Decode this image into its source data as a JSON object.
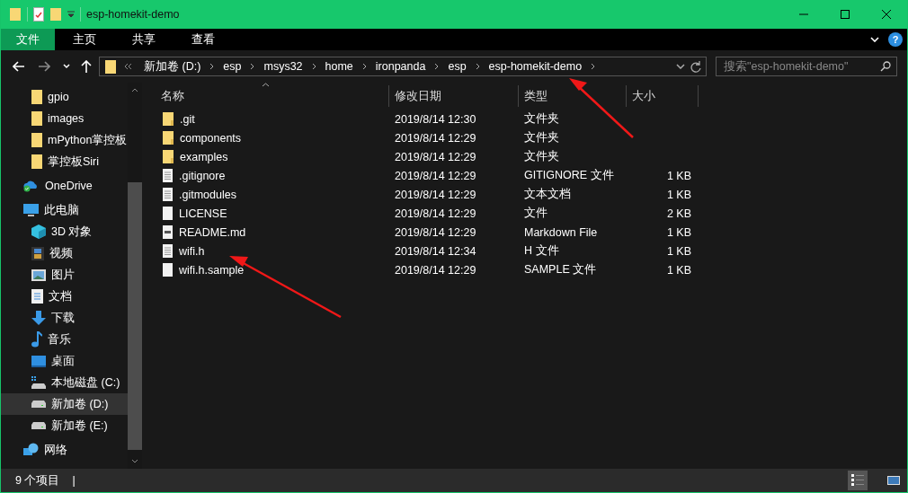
{
  "window": {
    "title": "esp-homekit-demo"
  },
  "ribbon": {
    "tabs": [
      {
        "label": "文件",
        "selected": true
      },
      {
        "label": "主页",
        "selected": false
      },
      {
        "label": "共享",
        "selected": false
      },
      {
        "label": "查看",
        "selected": false
      }
    ],
    "help": "?"
  },
  "address": {
    "segments": [
      "新加卷 (D:)",
      "esp",
      "msys32",
      "home",
      "ironpanda",
      "esp",
      "esp-homekit-demo"
    ]
  },
  "search": {
    "placeholder": "搜索\"esp-homekit-demo\""
  },
  "sidebar": {
    "quick_access_tail": [
      {
        "label": "gpio",
        "kind": "folder",
        "selected": false
      },
      {
        "label": "images",
        "kind": "folder",
        "selected": false
      },
      {
        "label": "mPython掌控板",
        "kind": "folder",
        "selected": false
      },
      {
        "label": "掌控板Siri",
        "kind": "folder",
        "selected": false
      }
    ],
    "items": [
      {
        "label": "OneDrive",
        "kind": "onedrive",
        "selected": false
      },
      {
        "label": "此电脑",
        "kind": "pc",
        "selected": false,
        "children": [
          {
            "label": "3D 对象",
            "kind": "cube",
            "selected": false
          },
          {
            "label": "视频",
            "kind": "video",
            "selected": false
          },
          {
            "label": "图片",
            "kind": "picture",
            "selected": false
          },
          {
            "label": "文档",
            "kind": "document",
            "selected": false
          },
          {
            "label": "下载",
            "kind": "download",
            "selected": false
          },
          {
            "label": "音乐",
            "kind": "music",
            "selected": false
          },
          {
            "label": "桌面",
            "kind": "desktop",
            "selected": false
          },
          {
            "label": "本地磁盘 (C:)",
            "kind": "system-drive",
            "selected": false
          },
          {
            "label": "新加卷 (D:)",
            "kind": "drive",
            "selected": true
          },
          {
            "label": "新加卷 (E:)",
            "kind": "drive",
            "selected": false
          }
        ]
      },
      {
        "label": "网络",
        "kind": "network",
        "selected": false
      }
    ]
  },
  "table": {
    "columns": [
      "名称",
      "修改日期",
      "类型",
      "大小"
    ],
    "rows": [
      {
        "name": ".git",
        "modified": "2019/8/14 12:30",
        "type": "文件夹",
        "kind": "folder"
      },
      {
        "name": "components",
        "modified": "2019/8/14 12:29",
        "type": "文件夹",
        "kind": "folder"
      },
      {
        "name": "examples",
        "modified": "2019/8/14 12:29",
        "type": "文件夹",
        "kind": "folder"
      },
      {
        "name": ".gitignore",
        "modified": "2019/8/14 12:29",
        "type": "GITIGNORE 文件",
        "size": "1 KB",
        "kind": "text"
      },
      {
        "name": ".gitmodules",
        "modified": "2019/8/14 12:29",
        "type": "文本文档",
        "size": "1 KB",
        "kind": "text"
      },
      {
        "name": "LICENSE",
        "modified": "2019/8/14 12:29",
        "type": "文件",
        "size": "2 KB",
        "kind": "blank"
      },
      {
        "name": "README.md",
        "modified": "2019/8/14 12:29",
        "type": "Markdown File",
        "size": "1 KB",
        "kind": "markdown"
      },
      {
        "name": "wifi.h",
        "modified": "2019/8/14 12:34",
        "type": "H 文件",
        "size": "1 KB",
        "kind": "text"
      },
      {
        "name": "wifi.h.sample",
        "modified": "2019/8/14 12:29",
        "type": "SAMPLE 文件",
        "size": "1 KB",
        "kind": "blank"
      }
    ]
  },
  "status_bar": {
    "count": "9 个项目",
    "separator": "|"
  }
}
